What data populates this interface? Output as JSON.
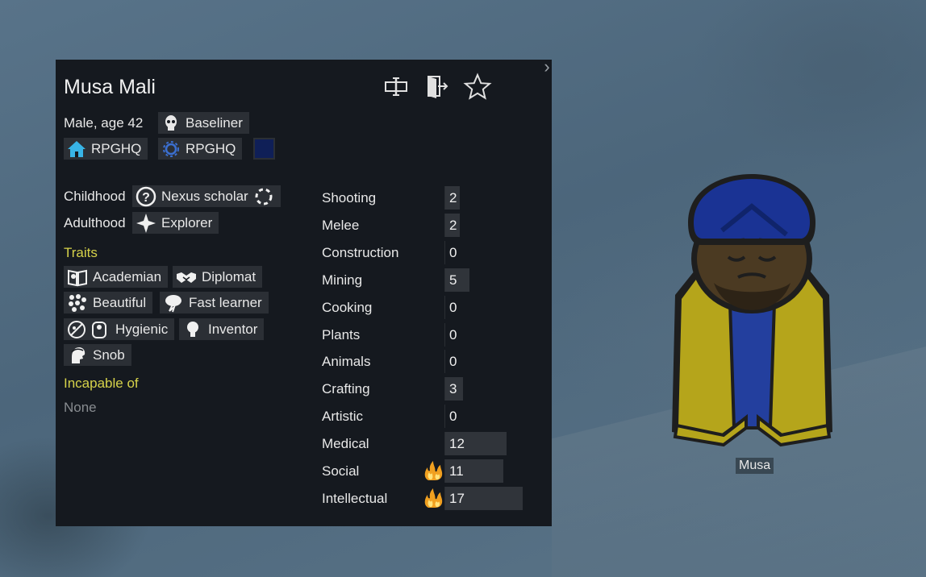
{
  "pawn": {
    "name": "Musa Mali",
    "summary": "Male, age 42",
    "xenotype": "Baseliner",
    "faction": "RPGHQ",
    "ideoligion": "RPGHQ",
    "ideo_color": "#0f1f57",
    "map_label": "Musa"
  },
  "header_icons": [
    "rename-icon",
    "banish-icon",
    "favorite-star-icon"
  ],
  "backstory": {
    "childhood_label": "Childhood",
    "childhood": "Nexus scholar",
    "adulthood_label": "Adulthood",
    "adulthood": "Explorer"
  },
  "traits": {
    "heading": "Traits",
    "items": [
      "Academian",
      "Diplomat",
      "Beautiful",
      "Fast learner",
      "Hygienic",
      "Inventor",
      "Snob"
    ]
  },
  "incapable": {
    "heading": "Incapable of",
    "value": "None"
  },
  "skills": [
    {
      "name": "Shooting",
      "level": 2,
      "passion": 0
    },
    {
      "name": "Melee",
      "level": 2,
      "passion": 0
    },
    {
      "name": "Construction",
      "level": 0,
      "passion": 0
    },
    {
      "name": "Mining",
      "level": 5,
      "passion": 0
    },
    {
      "name": "Cooking",
      "level": 0,
      "passion": 0
    },
    {
      "name": "Plants",
      "level": 0,
      "passion": 0
    },
    {
      "name": "Animals",
      "level": 0,
      "passion": 0
    },
    {
      "name": "Crafting",
      "level": 3,
      "passion": 0
    },
    {
      "name": "Artistic",
      "level": 0,
      "passion": 0
    },
    {
      "name": "Medical",
      "level": 12,
      "passion": 0
    },
    {
      "name": "Social",
      "level": 11,
      "passion": 2
    },
    {
      "name": "Intellectual",
      "level": 17,
      "passion": 2
    }
  ],
  "colors": {
    "panel_bg": "#15191f",
    "chip_bg": "#2b2f35",
    "heading_yellow": "#d6d24a",
    "disabled_grey": "#888c90"
  }
}
